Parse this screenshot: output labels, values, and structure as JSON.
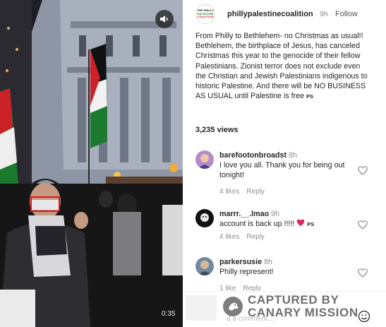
{
  "video": {
    "timestamp": "0:35",
    "mute_icon": "speaker-muted-icon"
  },
  "post": {
    "avatar_text": [
      "THE PHILLY",
      "PALESTINE",
      "COALITION"
    ],
    "username": "phillypalestinecoalition",
    "time": "9h",
    "follow": "Follow",
    "caption": "From Philly to Bethlehem- no Christmas as usual!! Bethlehem, the birthplace of Jesus, has canceled Christmas this year to the genocide of their fellow Palestinians. Zionist terror does not exclude even the Christian and Jewish Palestinians indigenous to historic Palestine. And there will be NO BUSINESS AS USUAL until Palestine is free",
    "caption_flag": "PS",
    "views": "3,235 views"
  },
  "comments": [
    {
      "user": "barefootonbroadst",
      "time": "8h",
      "text": "I love you all. Thank you for being out tonight!",
      "likes": "4 likes",
      "reply": "Reply"
    },
    {
      "user": "marrr.__.lmao",
      "time": "9h",
      "text": "account is back up !!!!! ",
      "text_flag": "PS",
      "likes": "4 likes",
      "reply": "Reply"
    },
    {
      "user": "parkersusie",
      "time": "8h",
      "text": "Philly represent!",
      "likes": "1 like",
      "reply": "Reply"
    }
  ],
  "footer": {
    "add_comment_placeholder": "d a comment..."
  },
  "watermark": {
    "line1": "CAPTURED BY",
    "line2": "CANARY MISSION"
  },
  "colors": {
    "heart_red": "#e0245e",
    "face_box": "#e0141b"
  }
}
